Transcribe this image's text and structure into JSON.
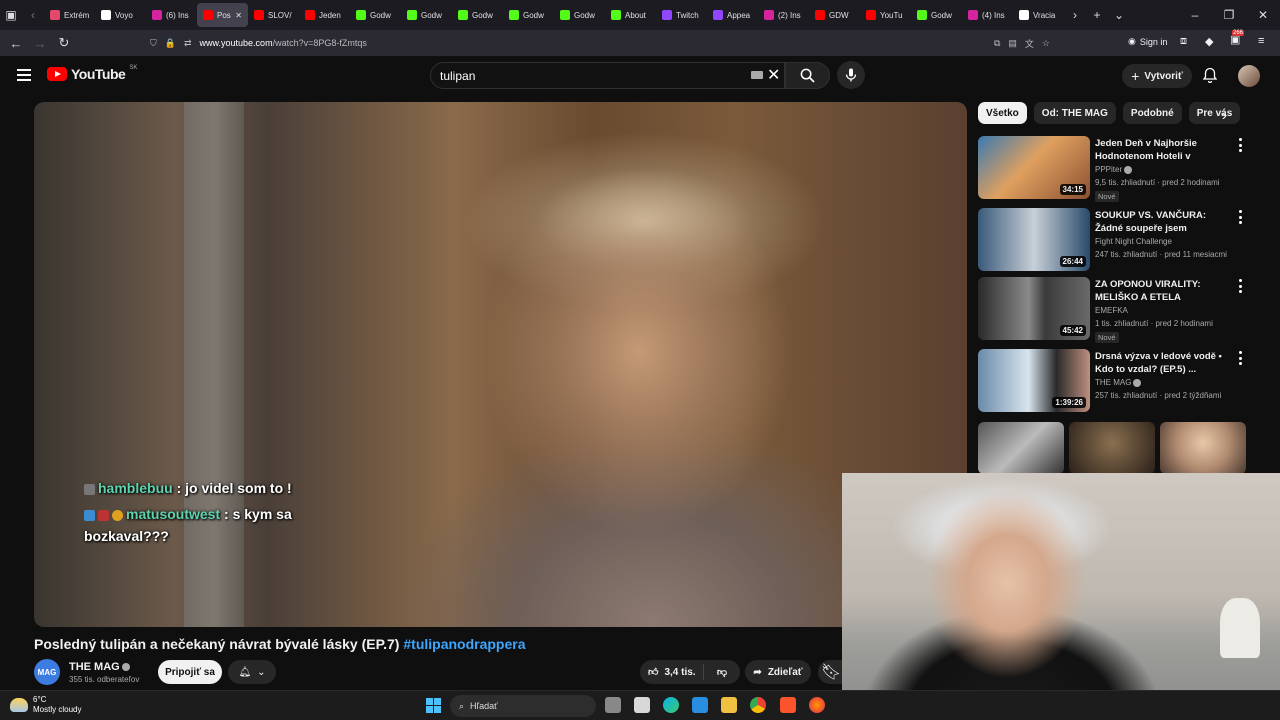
{
  "browser": {
    "tabs": [
      {
        "label": "Extrém",
        "color": "#e2496a",
        "active": false
      },
      {
        "label": "Voyo",
        "color": "#ffffff",
        "active": false
      },
      {
        "label": "(6) Ins",
        "color": "#d6249f",
        "active": false
      },
      {
        "label": "Pos",
        "color": "#ff0000",
        "active": true
      },
      {
        "label": "SLOV/",
        "color": "#ff0000",
        "active": false
      },
      {
        "label": "Jeden",
        "color": "#ff0000",
        "active": false
      },
      {
        "label": "Godw",
        "color": "#53fc18",
        "active": false
      },
      {
        "label": "Godw",
        "color": "#53fc18",
        "active": false
      },
      {
        "label": "Godw",
        "color": "#53fc18",
        "active": false
      },
      {
        "label": "Godw",
        "color": "#53fc18",
        "active": false
      },
      {
        "label": "Godw",
        "color": "#53fc18",
        "active": false
      },
      {
        "label": "About",
        "color": "#53fc18",
        "active": false
      },
      {
        "label": "Twitch",
        "color": "#9146ff",
        "active": false
      },
      {
        "label": "Appea",
        "color": "#9146ff",
        "active": false
      },
      {
        "label": "(2) Ins",
        "color": "#d6249f",
        "active": false
      },
      {
        "label": "GDW",
        "color": "#ff0000",
        "active": false
      },
      {
        "label": "YouTu",
        "color": "#ff0000",
        "active": false
      },
      {
        "label": "Godw",
        "color": "#53fc18",
        "active": false
      },
      {
        "label": "(4) Ins",
        "color": "#d6249f",
        "active": false
      },
      {
        "label": "Vracia",
        "color": "#ffffff",
        "active": false
      }
    ],
    "url_host": "www.youtube.com",
    "url_path": "/watch?v=8PG8-fZmtqs",
    "signin_label": "Sign in",
    "ext_badge": "266"
  },
  "youtube": {
    "logo_text": "YouTube",
    "country_code": "SK",
    "search_value": "tulipan",
    "create_label": "Vytvoriť",
    "video": {
      "title": "Posledný tulipán a nečekaný návrat bývalé lásky (EP.7)",
      "hashtag": "#tulipanodrappera",
      "channel": "THE MAG",
      "channel_logo_text": "MAG",
      "subscribers": "355 tis. odberateľov",
      "subscribe_label": "Pripojiť sa",
      "likes": "3,4 tis.",
      "share_label": "Zdieľať"
    },
    "chat": [
      {
        "user": "hamblebuu",
        "message": ": jo videl som to !"
      },
      {
        "user": "matusoutwest",
        "message": ": s kym sa"
      },
      {
        "user": "",
        "message": "bozkaval???"
      }
    ],
    "chips": [
      "Všetko",
      "Od: THE MAG",
      "Podobné",
      "Pre vás"
    ],
    "recommendations": [
      {
        "title": "Jeden Deň v Najhoršie Hodnotenom Hoteli v Kaliforni...",
        "channel": "PPPiter",
        "meta": "9,5 tis. zhliadnutí · pred 2 hodinami",
        "badge": "Nové",
        "duration": "34:15"
      },
      {
        "title": "SOUKUP VS. VANČURA: Žádné soupeře jsem neuplácel ...",
        "channel": "Fight Night Challenge",
        "meta": "247 tis. zhliadnutí · pred 11 mesiacmi",
        "badge": "",
        "duration": "26:44"
      },
      {
        "title": "ZA OPONOU VIRALITY: MELIŠKO A ETELA",
        "channel": "EMEFKA",
        "meta": "1 tis. zhliadnutí · pred 2 hodinami",
        "badge": "Nové",
        "duration": "45:42"
      },
      {
        "title": "Drsná výzva v ledové vodě • Kdo to vzdal? (EP.5) ...",
        "channel": "THE MAG",
        "meta": "257 tis. zhliadnutí · pred 2 týždňami",
        "badge": "",
        "duration": "1:39:26"
      }
    ]
  },
  "taskbar": {
    "temperature": "6°C",
    "weather": "Mostly cloudy",
    "search_placeholder": "Hľadať"
  }
}
